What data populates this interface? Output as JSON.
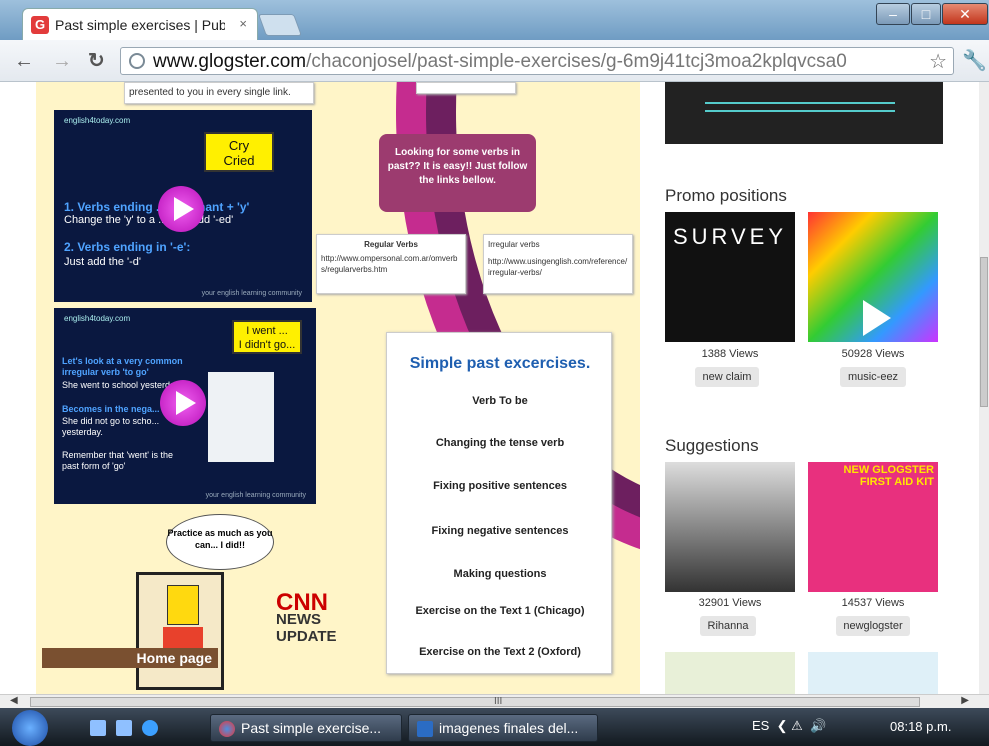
{
  "browser": {
    "tab_title": "Past simple exercises | Publi",
    "tab_close": "×",
    "favicon_letter": "G",
    "url_host": "www.glogster.com",
    "url_path": "/chaconjosel/past-simple-exercises/g-6m9j41tcj3moa2kplqvcsa0"
  },
  "poster": {
    "intro_text": "presented to you in every single link.",
    "video1": {
      "brand": "english4today.com",
      "bubble_line1": "Cry",
      "bubble_line2": "Cried",
      "rule1_title": "1. Verbs ending ... onsonant + 'y'",
      "rule1_body": "Change the 'y' to a ... and add '-ed'",
      "rule2_title": "2. Verbs ending in '-e':",
      "rule2_body": "Just add the '-d'",
      "footer": "your english learning community"
    },
    "video2": {
      "brand": "english4today.com",
      "bubble_line1": "I went ...",
      "bubble_line2": "I didn't go...",
      "line1": "Let's look at a very common irregular verb 'to go'",
      "line2": "She went to school yesterday.",
      "line3": "Becomes in the nega...",
      "line4": "She did not go to scho... yesterday.",
      "line5": "Remember that 'went' is the past form of 'go'",
      "footer": "your english learning community"
    },
    "looking_text": "Looking for some verbs in past?? It is easy!! Just follow the links bellow.",
    "note_regular_title": "Regular Verbs",
    "note_regular_url": "http://www.ompersonal.com.ar/omverbs/regularverbs.htm",
    "note_irregular_title": "Irregular verbs",
    "note_irregular_url": "http://www.usingenglish.com/reference/irregular-verbs/",
    "exercises_title": "Simple past excercises.",
    "exercises": [
      "Verb To be",
      "Changing the tense verb",
      "Fixing positive sentences",
      "Fixing negative sentences",
      "Making questions",
      "Exercise on the Text 1 (Chicago)",
      "Exercise on the Text 2 (Oxford)"
    ],
    "speech_text": "Practice as much as you can... I did!!",
    "home_label": "Home page",
    "cnn_line1": "CNN",
    "cnn_line2": "NEWS",
    "cnn_line3": "UPDATE"
  },
  "sidebar": {
    "promo_heading": "Promo positions",
    "promo_items": [
      {
        "views": "1388 Views",
        "tag": "new claim",
        "thumb_text": "SURVEY"
      },
      {
        "views": "50928 Views",
        "tag": "music-eez",
        "thumb_text": ""
      }
    ],
    "suggest_heading": "Suggestions",
    "suggest_items": [
      {
        "views": "32901 Views",
        "tag": "Rihanna",
        "thumb_text": ""
      },
      {
        "views": "14537 Views",
        "tag": "newglogster",
        "thumb_text": "NEW GLOGSTER FIRST AID KIT"
      }
    ]
  },
  "scrollbar": {
    "grip": "III"
  },
  "taskbar": {
    "items": [
      "Past simple exercise...",
      "imagenes finales del..."
    ],
    "lang": "ES",
    "time": "08:18 p.m."
  }
}
